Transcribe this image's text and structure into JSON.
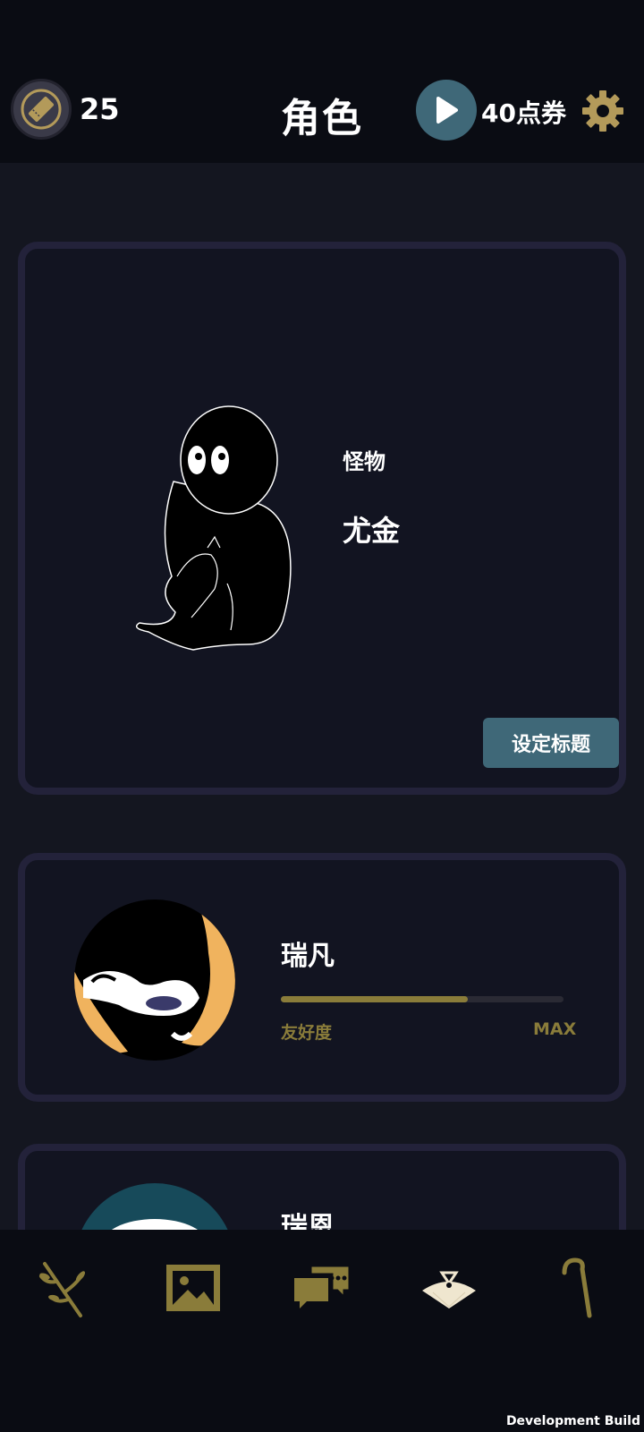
{
  "header": {
    "ticket_count": "25",
    "title": "角色",
    "points_label": "40点券"
  },
  "featured": {
    "type_label": "怪物",
    "name": "尤金",
    "set_title_button": "设定标题"
  },
  "characters": [
    {
      "name": "瑞凡",
      "affinity_label": "友好度",
      "affinity_status": "MAX",
      "affinity_fraction": 0.66
    },
    {
      "name": "瑞恩"
    }
  ],
  "bottom_nav": [
    {
      "icon": "branch-icon"
    },
    {
      "icon": "gallery-icon"
    },
    {
      "icon": "chat-icon"
    },
    {
      "icon": "fan-icon",
      "active": true
    },
    {
      "icon": "cane-icon"
    }
  ],
  "footer": {
    "build_label": "Development Build"
  },
  "colors": {
    "accent_teal": "#3f6878",
    "accent_gold": "#8a7c3a",
    "nav_active": "#efe6cf"
  }
}
